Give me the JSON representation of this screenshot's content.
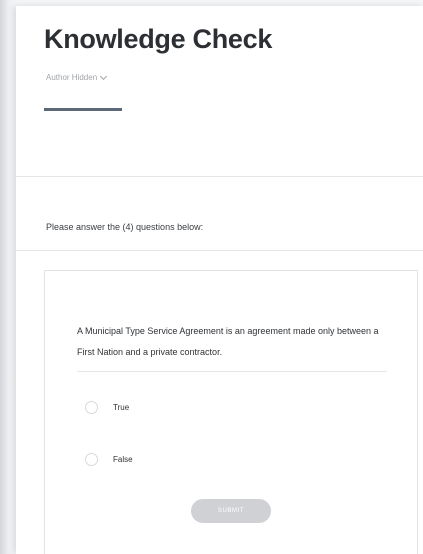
{
  "header": {
    "title": "Knowledge Check",
    "author": "Author Hidden"
  },
  "instructions": "Please answer the (4) questions below:",
  "question": {
    "text": "A Municipal Type Service Agreement is an agreement made only between a First Nation and a private contractor.",
    "options": [
      {
        "label": "True",
        "selected": false
      },
      {
        "label": "False",
        "selected": false
      }
    ],
    "submit_label": "SUBMIT"
  },
  "colors": {
    "title_text": "#2c2f33",
    "accent_bar": "#5b6877",
    "submit_bg": "#cfd1d4"
  }
}
